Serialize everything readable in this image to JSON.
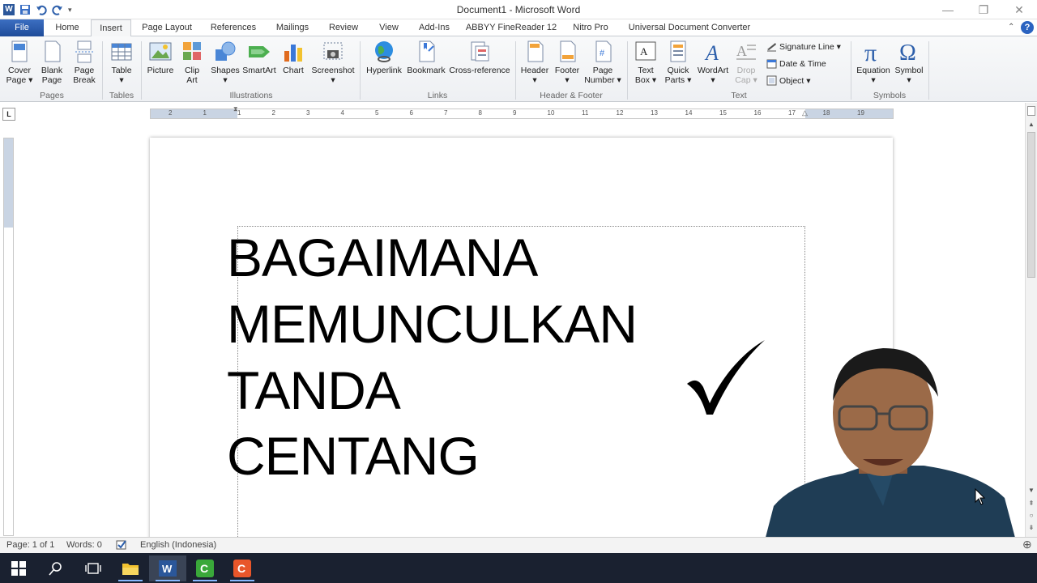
{
  "window": {
    "title": "Document1 - Microsoft Word"
  },
  "tabs": [
    "File",
    "Home",
    "Insert",
    "Page Layout",
    "References",
    "Mailings",
    "Review",
    "View",
    "Add-Ins",
    "ABBYY FineReader 12",
    "Nitro Pro",
    "Universal Document Converter"
  ],
  "active_tab": "Insert",
  "ribbon": {
    "pages": {
      "cover": "Cover\nPage ▾",
      "blank": "Blank\nPage",
      "break": "Page\nBreak",
      "group": "Pages"
    },
    "tables": {
      "table": "Table\n▾",
      "group": "Tables"
    },
    "illustrations": {
      "picture": "Picture",
      "clipart": "Clip\nArt",
      "shapes": "Shapes\n▾",
      "smartart": "SmartArt",
      "chart": "Chart",
      "screenshot": "Screenshot\n▾",
      "group": "Illustrations"
    },
    "links": {
      "hyperlink": "Hyperlink",
      "bookmark": "Bookmark",
      "crossref": "Cross-reference",
      "group": "Links"
    },
    "headerfooter": {
      "header": "Header\n▾",
      "footer": "Footer\n▾",
      "pagenumber": "Page\nNumber ▾",
      "group": "Header & Footer"
    },
    "text": {
      "textbox": "Text\nBox ▾",
      "quickparts": "Quick\nParts ▾",
      "wordart": "WordArt\n▾",
      "dropcap": "Drop\nCap ▾",
      "signature": "Signature Line ▾",
      "datetime": "Date & Time",
      "object": "Object ▾",
      "group": "Text"
    },
    "symbols": {
      "equation": "Equation\n▾",
      "symbol": "Symbol\n▾",
      "group": "Symbols"
    }
  },
  "ruler": {
    "numbers": [
      "2",
      "1",
      "1",
      "2",
      "3",
      "4",
      "5",
      "6",
      "7",
      "8",
      "9",
      "10",
      "11",
      "12",
      "13",
      "14",
      "15",
      "16",
      "17",
      "18",
      "19"
    ]
  },
  "document": {
    "lines": [
      "BAGAIMANA",
      "MEMUNCULKAN",
      "TANDA",
      "CENTANG"
    ],
    "checkmark": "✓"
  },
  "status": {
    "page": "Page: 1 of 1",
    "words": "Words: 0",
    "language": "English (Indonesia)"
  },
  "colors": {
    "file_tab": "#2b579a",
    "taskbar": "#1a2130",
    "shirt": "#1f3d55"
  }
}
